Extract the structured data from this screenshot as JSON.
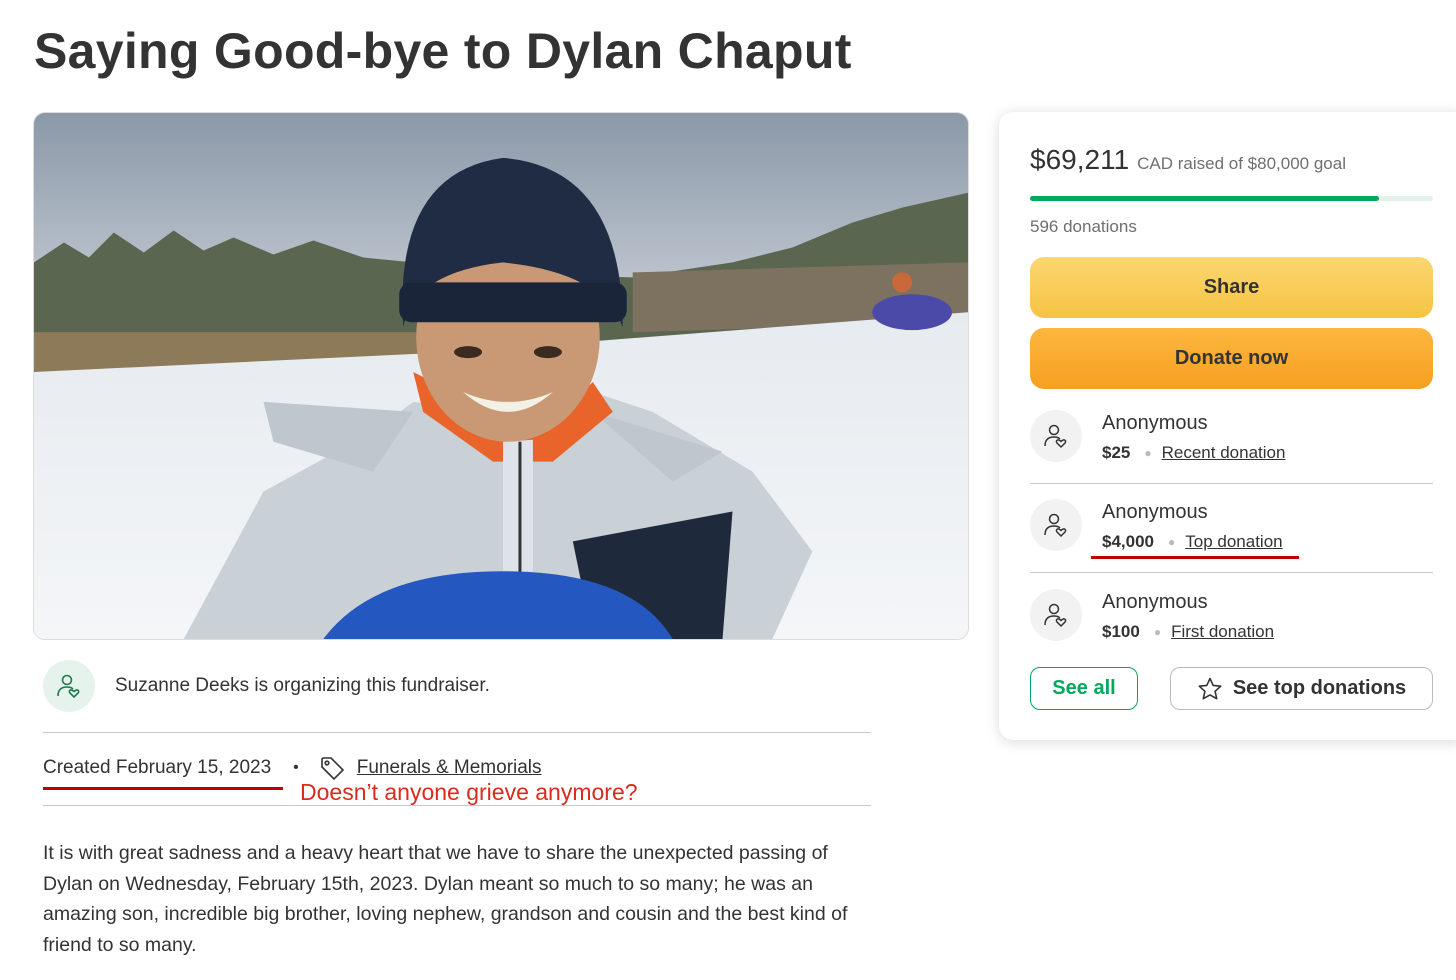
{
  "title": "Saying Good-bye to Dylan Chaput",
  "organizer": {
    "text": "Suzanne Deeks is organizing this fundraiser."
  },
  "meta": {
    "created": "Created February 15, 2023",
    "bullet": "•",
    "category": "Funerals & Memorials",
    "annotation": "Doesn’t anyone grieve anymore?"
  },
  "story": "It is with great sadness and a heavy heart that we have to share the unexpected passing of Dylan on Wednesday, February 15th, 2023. Dylan meant so much to so many; he was an amazing son, incredible big brother, loving nephew, grandson and cousin and the best kind of friend to so many.",
  "card": {
    "raised_amount": "$69,211",
    "raised_goal": "CAD raised of $80,000 goal",
    "progress": 0.865,
    "donation_count": "596 donations",
    "share_label": "Share",
    "donate_label": "Donate now",
    "donors": [
      {
        "name": "Anonymous",
        "amount": "$25",
        "label": "Recent donation"
      },
      {
        "name": "Anonymous",
        "amount": "$4,000",
        "label": "Top donation"
      },
      {
        "name": "Anonymous",
        "amount": "$100",
        "label": "First donation"
      }
    ],
    "see_all_label": "See all",
    "see_top_label": "See top donations"
  },
  "colors": {
    "accent_green": "#02a95c",
    "share_yellow": "#f6c343",
    "donate_orange": "#f5a020",
    "annotation_red": "#d92b1e"
  },
  "icons": [
    "heart-hand-icon",
    "tag-icon",
    "star-icon"
  ]
}
